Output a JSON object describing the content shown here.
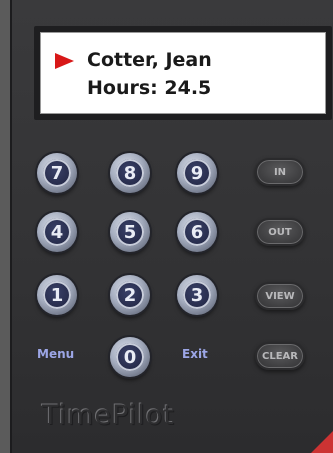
{
  "display": {
    "name": "Cotter, Jean",
    "hours_line": "Hours: 24.5"
  },
  "keypad": {
    "k7": "7",
    "k8": "8",
    "k9": "9",
    "k4": "4",
    "k5": "5",
    "k6": "6",
    "k1": "1",
    "k2": "2",
    "k3": "3",
    "k0": "0",
    "menu_label": "Menu",
    "exit_label": "Exit"
  },
  "function_keys": {
    "in": "IN",
    "out": "OUT",
    "view": "VIEW",
    "clear": "CLEAR"
  },
  "brand": "TimePilot",
  "colors": {
    "pointer": "#d81818",
    "label": "#9ca6e6",
    "body": "#353537"
  }
}
